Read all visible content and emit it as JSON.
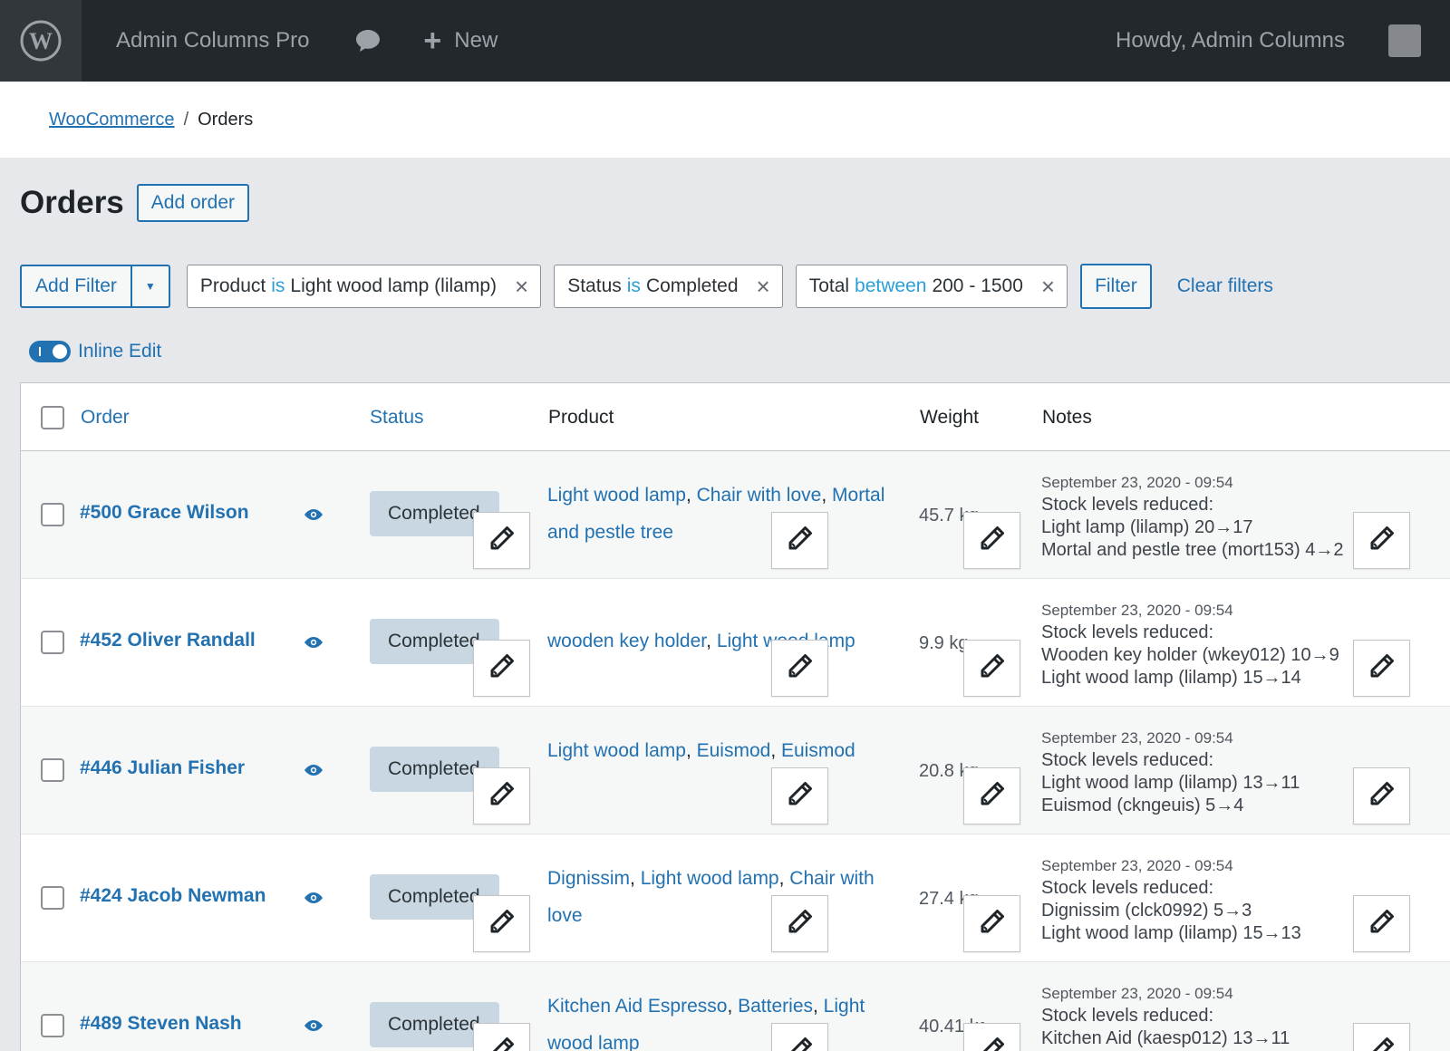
{
  "admin_bar": {
    "site_name": "Admin Columns Pro",
    "new_label": "New",
    "howdy": "Howdy,",
    "user": "Admin Columns"
  },
  "breadcrumb": {
    "parent": "WooCommerce",
    "separator": "/",
    "current": "Orders"
  },
  "page": {
    "title": "Orders",
    "add_button": "Add order"
  },
  "filters": {
    "add_filter_label": "Add Filter",
    "chips": [
      {
        "field": "Product",
        "op": "is",
        "value": "Light wood lamp (lilamp)"
      },
      {
        "field": "Status",
        "op": "is",
        "value": "Completed"
      },
      {
        "field": "Total",
        "op": "between",
        "value": "200 - 1500"
      }
    ],
    "filter_button": "Filter",
    "clear_label": "Clear filters"
  },
  "inline_edit": {
    "label": "Inline Edit",
    "enabled": true
  },
  "table": {
    "columns": {
      "order": "Order",
      "status": "Status",
      "product": "Product",
      "weight": "Weight",
      "notes": "Notes"
    },
    "rows": [
      {
        "order": "#500 Grace Wilson",
        "status": "Completed",
        "products": [
          "Light wood lamp",
          "Chair with love",
          "Mortal and pestle tree"
        ],
        "weight": "45.7 kg",
        "note_date": "September 23, 2020 - 09:54",
        "note_lines": [
          "Stock levels reduced:",
          "Light lamp (lilamp) 20→17",
          "Mortal and pestle tree (mort153) 4→2"
        ]
      },
      {
        "order": "#452 Oliver Randall",
        "status": "Completed",
        "products": [
          "wooden key holder",
          "Light wood lamp"
        ],
        "weight": "9.9 kg",
        "note_date": "September 23, 2020 - 09:54",
        "note_lines": [
          "Stock levels reduced:",
          "Wooden key holder (wkey012) 10→9",
          "Light wood lamp (lilamp) 15→14"
        ]
      },
      {
        "order": "#446 Julian Fisher",
        "status": "Completed",
        "products": [
          "Light wood lamp",
          "Euismod",
          "Euismod"
        ],
        "weight": "20.8 kg",
        "note_date": "September 23, 2020 - 09:54",
        "note_lines": [
          "Stock levels reduced:",
          "Light wood lamp (lilamp) 13→11",
          "Euismod (ckngeuis) 5→4"
        ]
      },
      {
        "order": "#424 Jacob Newman",
        "status": "Completed",
        "products": [
          "Dignissim",
          "Light wood lamp",
          "Chair with love"
        ],
        "weight": "27.4 kg",
        "note_date": "September 23, 2020 - 09:54",
        "note_lines": [
          "Stock levels reduced:",
          "Dignissim (clck0992) 5→3",
          "Light wood lamp (lilamp) 15→13"
        ]
      },
      {
        "order": "#489 Steven Nash",
        "status": "Completed",
        "products": [
          "Kitchen Aid Espresso",
          "Batteries",
          "Light wood lamp"
        ],
        "weight": "40.41 kg",
        "note_date": "September 23, 2020 - 09:54",
        "note_lines": [
          "Stock levels reduced:",
          "Kitchen Aid (kaesp012) 13→11"
        ]
      }
    ]
  },
  "colors": {
    "admin_bar_bg": "#23282d",
    "link": "#2271b1",
    "status_badge": "#c8d7e1",
    "filter_op": "#2a9fd6"
  }
}
